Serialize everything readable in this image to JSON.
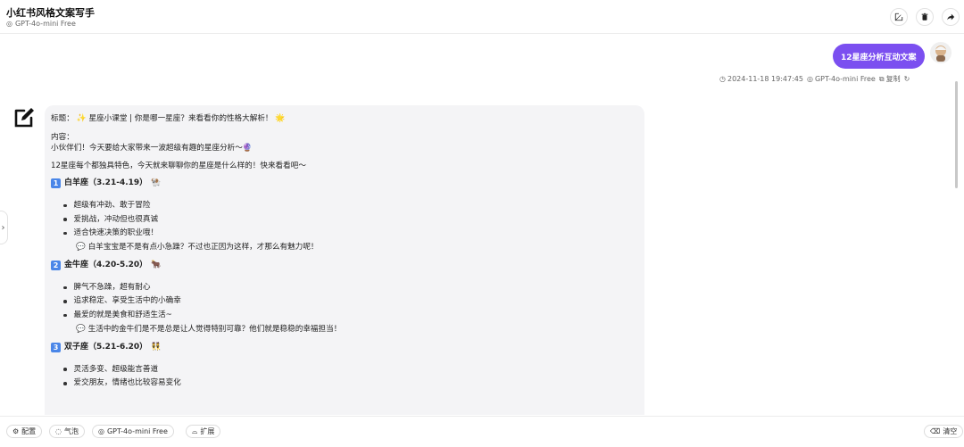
{
  "header": {
    "title": "小红书风格文案写手",
    "model": "GPT-4o-mini Free"
  },
  "user_message": {
    "text": "12星座分析互动文案",
    "timestamp": "2024-11-18 19:47:45",
    "model": "GPT-4o-mini Free",
    "copy_label": "复制"
  },
  "bot_message": {
    "title_prefix": "标题：",
    "title_text": "星座小课堂 | 你是哪一星座？来看看你的性格大解析！",
    "content_label": "内容：",
    "intro1": "小伙伴们！今天要给大家带来一波超级有趣的星座分析～",
    "intro2": "12星座每个都独具特色，今天就来聊聊你的星座是什么样的！快来看看吧～",
    "sections": [
      {
        "badge": "1",
        "heading": "白羊座（3.21-4.19）",
        "bullets": [
          "超级有冲劲、敢于冒险",
          "爱挑战，冲动但也很真诚",
          "适合快速决策的职业哦！"
        ],
        "note": "白羊宝宝是不是有点小急躁？不过也正因为这样，才那么有魅力呢！"
      },
      {
        "badge": "2",
        "heading": "金牛座（4.20-5.20）",
        "bullets": [
          "脾气不急躁，超有耐心",
          "追求稳定、享受生活中的小确幸",
          "最爱的就是美食和舒适生活~"
        ],
        "note": "生活中的金牛们是不是总是让人觉得特别可靠？他们就是稳稳的幸福担当！"
      },
      {
        "badge": "3",
        "heading": "双子座（5.21-6.20）",
        "bullets": [
          "灵活多变、超级能言善道",
          "爱交朋友，情绪也比较容易变化"
        ],
        "note": ""
      }
    ]
  },
  "toolbar": {
    "config": "配置",
    "bubble": "气泡",
    "model": "GPT-4o-mini Free",
    "extend": "扩展",
    "clear": "清空"
  },
  "colors": {
    "accent": "#7b4ff0",
    "badge": "#4a86e8"
  }
}
